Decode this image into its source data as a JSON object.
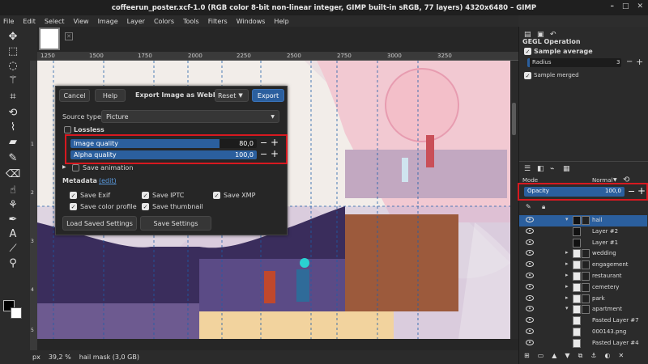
{
  "title": "coffeerun_poster.xcf-1.0 (RGB color 8-bit non-linear integer, GIMP built-in sRGB, 77 layers) 4320x6480 – GIMP",
  "menu": [
    "File",
    "Edit",
    "Select",
    "View",
    "Image",
    "Layer",
    "Colors",
    "Tools",
    "Filters",
    "Windows",
    "Help"
  ],
  "ruler_ticks": [
    "1250",
    "1500",
    "1750",
    "2000",
    "2250",
    "2500",
    "2750",
    "3000",
    "3250"
  ],
  "ruler_left": [
    "1",
    "2",
    "3",
    "4",
    "5"
  ],
  "status": {
    "unit": "px",
    "zoom": "39,2 %",
    "message": "hail mask (3,0 GB)"
  },
  "export": {
    "cancel": "Cancel",
    "help": "Help",
    "title": "Export Image as WebP",
    "reset": "Reset",
    "export": "Export",
    "source_type_label": "Source type",
    "source_type_value": "Picture",
    "lossless": "Lossless",
    "image_quality_label": "Image quality",
    "image_quality_value": "80,0",
    "image_quality_fraction": 0.8,
    "alpha_quality_label": "Alpha quality",
    "alpha_quality_value": "100,0",
    "alpha_quality_fraction": 1.0,
    "save_animation": "Save animation",
    "metadata_label": "Metadata",
    "metadata_edit": "(edit)",
    "save_exif": "Save Exif",
    "save_iptc": "Save IPTC",
    "save_xmp": "Save XMP",
    "save_color_profile": "Save color profile",
    "save_thumbnail": "Save thumbnail",
    "load_saved": "Load Saved Settings",
    "save_settings": "Save Settings"
  },
  "tool_options": {
    "heading": "GEGL Operation",
    "sample_average": "Sample average",
    "radius_label": "Radius",
    "radius_value": "3",
    "sample_merged": "Sample merged"
  },
  "layers": {
    "mode_label": "Mode",
    "mode_value": "Normal",
    "opacity_label": "Opacity",
    "opacity_value": "100,0",
    "opacity_fraction": 1.0,
    "rows": [
      {
        "name": "hail",
        "selected": true,
        "expand": "▾"
      },
      {
        "name": "Layer #2",
        "selected": false,
        "expand": ""
      },
      {
        "name": "Layer #1",
        "selected": false,
        "expand": ""
      },
      {
        "name": "wedding",
        "selected": false,
        "expand": "▸"
      },
      {
        "name": "engagement",
        "selected": false,
        "expand": "▸"
      },
      {
        "name": "restaurant",
        "selected": false,
        "expand": "▸"
      },
      {
        "name": "cemetery",
        "selected": false,
        "expand": "▸"
      },
      {
        "name": "park",
        "selected": false,
        "expand": "▸"
      },
      {
        "name": "apartment",
        "selected": false,
        "expand": "▾"
      },
      {
        "name": "Pasted Layer #7",
        "selected": false,
        "expand": ""
      },
      {
        "name": "000143.png",
        "selected": false,
        "expand": ""
      },
      {
        "name": "Pasted Layer #4",
        "selected": false,
        "expand": ""
      }
    ]
  },
  "colors": {
    "accent": "#2b5f9e",
    "highlight": "#d71920",
    "selected_row": "#2b5f9e"
  }
}
